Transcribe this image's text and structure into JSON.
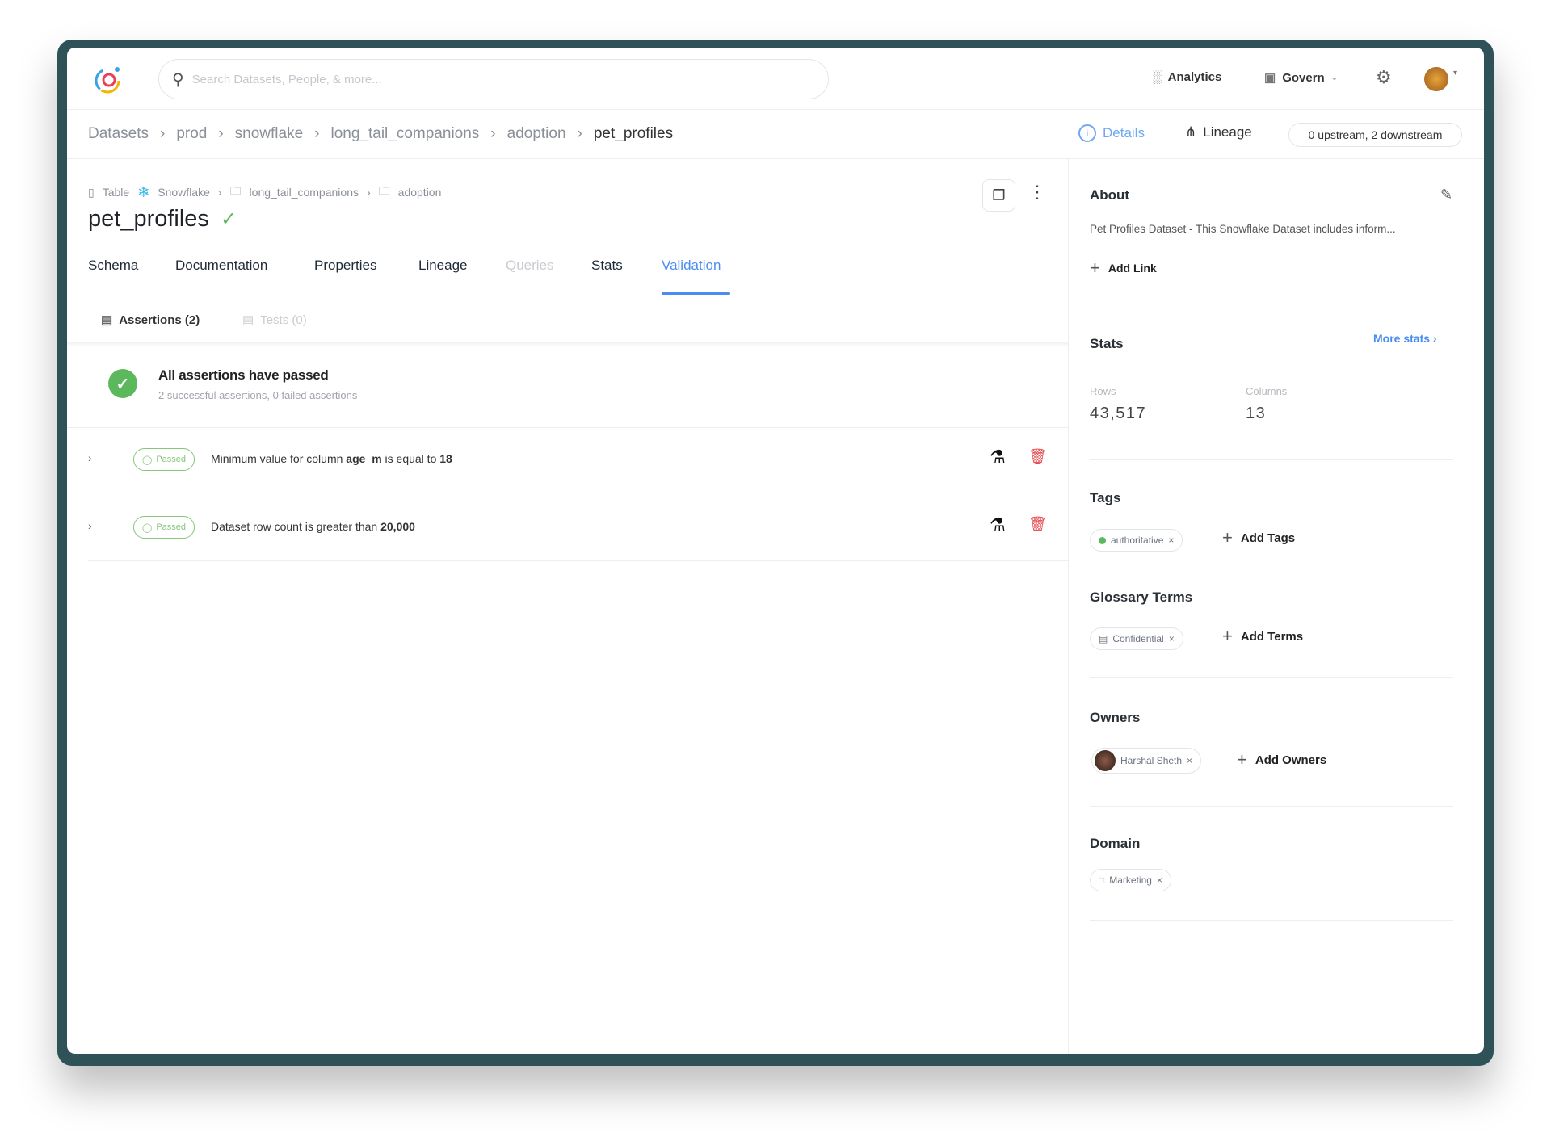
{
  "nav": {
    "search_placeholder": "Search Datasets, People, & more...",
    "analytics": "Analytics",
    "govern": "Govern"
  },
  "breadcrumb": [
    "Datasets",
    "prod",
    "snowflake",
    "long_tail_companions",
    "adoption",
    "pet_profiles"
  ],
  "view_toggle": {
    "details": "Details",
    "lineage": "Lineage",
    "lineage_summary": "0 upstream, 2 downstream"
  },
  "entity": {
    "type": "Table",
    "platform": "Snowflake",
    "path": [
      "long_tail_companions",
      "adoption"
    ],
    "name": "pet_profiles"
  },
  "tabs": [
    "Schema",
    "Documentation",
    "Properties",
    "Lineage",
    "Queries",
    "Stats",
    "Validation"
  ],
  "subtabs": {
    "assertions": "Assertions (2)",
    "tests": "Tests (0)"
  },
  "summary": {
    "title": "All assertions have passed",
    "subtitle": "2 successful assertions, 0 failed assertions"
  },
  "assertions": [
    {
      "status": "Passed",
      "prefix": "Minimum value for column ",
      "bold": "age_m",
      "middle": " is equal to ",
      "value": "18"
    },
    {
      "status": "Passed",
      "prefix": "Dataset row count is greater than ",
      "bold": "",
      "middle": "",
      "value": "20,000"
    }
  ],
  "sidebar": {
    "about": {
      "title": "About",
      "description": "Pet Profiles Dataset - This Snowflake Dataset includes inform...",
      "add_link": "Add Link"
    },
    "stats": {
      "title": "Stats",
      "more": "More stats ›",
      "rows_label": "Rows",
      "rows": "43,517",
      "columns_label": "Columns",
      "columns": "13"
    },
    "tags": {
      "title": "Tags",
      "items": [
        "authoritative"
      ],
      "add": "Add Tags"
    },
    "glossary": {
      "title": "Glossary Terms",
      "items": [
        "Confidential"
      ],
      "add": "Add Terms"
    },
    "owners": {
      "title": "Owners",
      "items": [
        "Harshal Sheth"
      ],
      "add": "Add Owners"
    },
    "domain": {
      "title": "Domain",
      "items": [
        "Marketing"
      ]
    }
  },
  "colors": {
    "accent": "#4a8df0",
    "success": "#5cb85c",
    "danger": "#e5484d",
    "frame": "#2f5158"
  }
}
